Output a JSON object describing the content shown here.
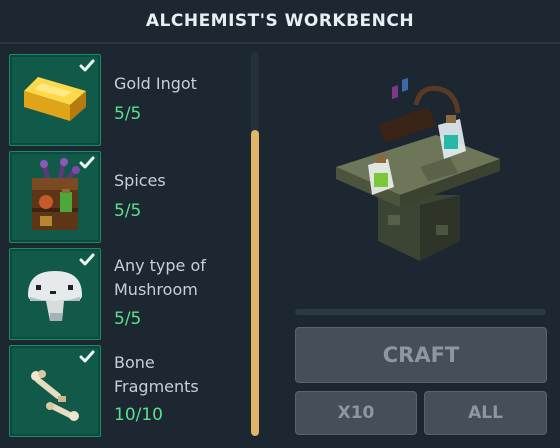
{
  "window": {
    "title": "ALCHEMIST'S WORKBENCH"
  },
  "ingredients": [
    {
      "name_line1": "Gold Ingot",
      "name_line2": "",
      "count": "5/5",
      "icon": "gold-ingot-icon",
      "checked": true
    },
    {
      "name_line1": "Spices",
      "name_line2": "",
      "count": "5/5",
      "icon": "spices-crate-icon",
      "checked": true
    },
    {
      "name_line1": "Any type of",
      "name_line2": "Mushroom",
      "count": "5/5",
      "icon": "mushroom-icon",
      "checked": true
    },
    {
      "name_line1": "Bone",
      "name_line2": "Fragments",
      "count": "10/10",
      "icon": "bone-fragments-icon",
      "checked": true
    }
  ],
  "buttons": {
    "craft": "CRAFT",
    "x10": "X10",
    "all": "ALL"
  },
  "colors": {
    "slot_bg": "#115a4a",
    "count_green": "#5be08b",
    "scrollbar_thumb": "#e0b56a",
    "button_bg": "#454f59"
  }
}
